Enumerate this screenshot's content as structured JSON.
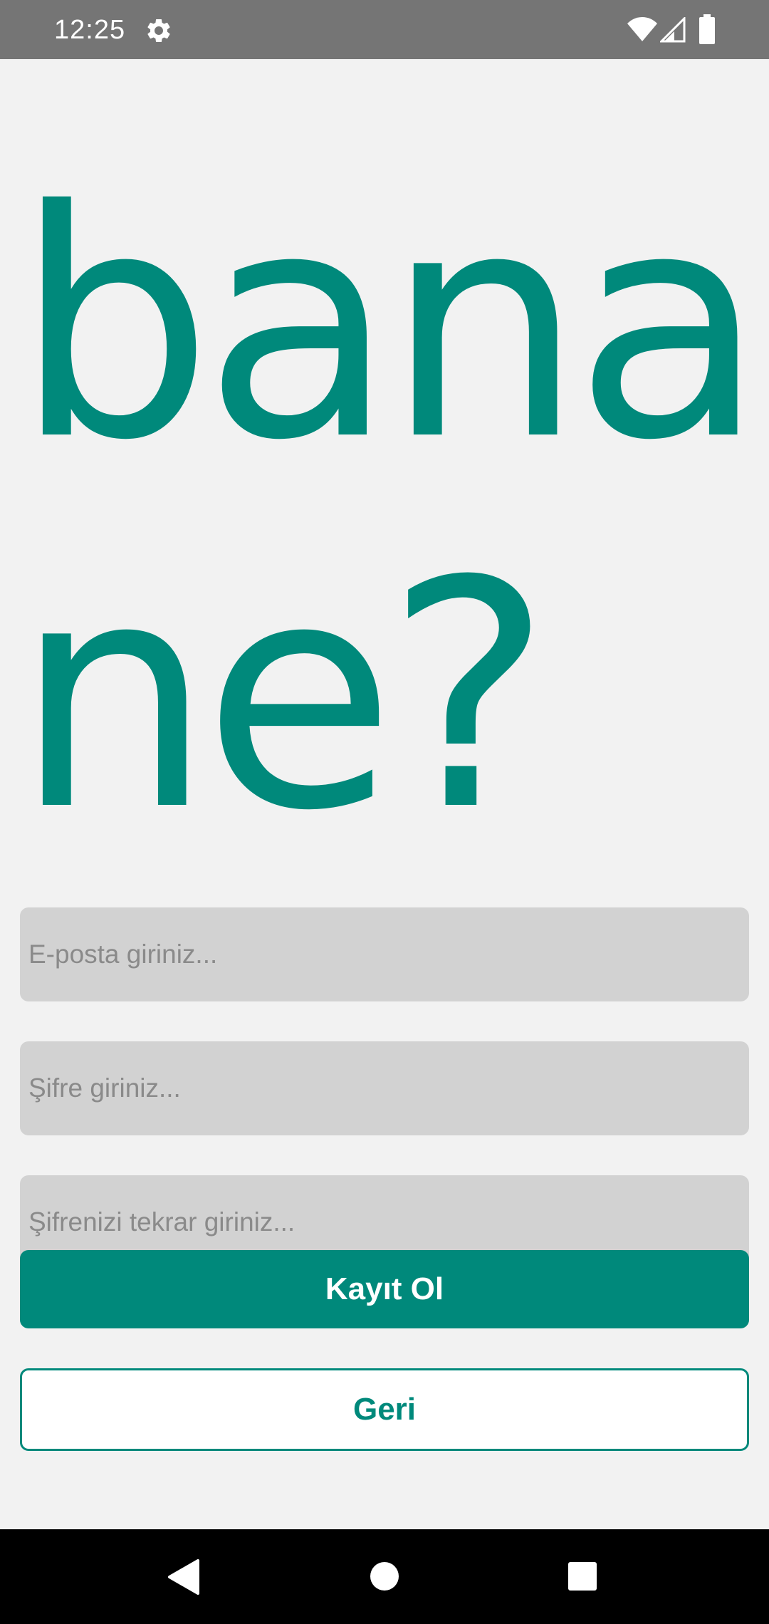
{
  "status_bar": {
    "time": "12:25",
    "icons": [
      "gear-icon",
      "wifi-icon",
      "signal-icon",
      "battery-icon"
    ]
  },
  "hero": {
    "title": "bana\nne?"
  },
  "form": {
    "email_placeholder": "E-posta giriniz...",
    "password_placeholder": "Şifre giriniz...",
    "password_repeat_placeholder": "Şifrenizi tekrar giriniz..."
  },
  "buttons": {
    "register_label": "Kayıt Ol",
    "back_label": "Geri"
  },
  "nav_bar": {
    "icons": [
      "back-icon",
      "home-icon",
      "recents-icon"
    ]
  },
  "colors": {
    "accent": "#00897b",
    "background": "#f2f2f2",
    "field_background": "#d2d2d2",
    "status_bar": "#757575",
    "nav_bar": "#000000"
  }
}
